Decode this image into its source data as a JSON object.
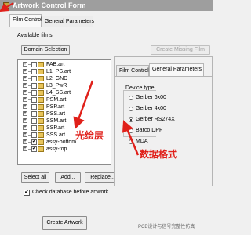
{
  "window": {
    "title": "Artwork Control Form"
  },
  "tabs": [
    {
      "label": "Film Control",
      "active": true
    },
    {
      "label": "General Parameters",
      "active": false
    }
  ],
  "available_films_label": "Available films",
  "buttons": {
    "domain_selection": "Domain Selection",
    "create_missing_film": "Create Missing Film",
    "select_all": "Select all",
    "add": "Add...",
    "replace": "Replace...",
    "create_artwork": "Create Artwork"
  },
  "films": [
    {
      "name": "FAB.art",
      "checked": false
    },
    {
      "name": "L1_PS.art",
      "checked": false
    },
    {
      "name": "L2_GND",
      "checked": false
    },
    {
      "name": "L3_PwR",
      "checked": false
    },
    {
      "name": "L4_SS.art",
      "checked": false
    },
    {
      "name": "PSM.art",
      "checked": false
    },
    {
      "name": "PSP.art",
      "checked": false
    },
    {
      "name": "PSS.art",
      "checked": false
    },
    {
      "name": "SSM.art",
      "checked": false
    },
    {
      "name": "SSP.art",
      "checked": false
    },
    {
      "name": "SSS.art",
      "checked": false
    },
    {
      "name": "assy-bottom",
      "checked": true
    },
    {
      "name": "assy-top",
      "checked": true
    }
  ],
  "check_db": {
    "label": "Check database before artwork",
    "checked": true
  },
  "overlay": {
    "tabs": [
      {
        "label": "Film Control",
        "active": false
      },
      {
        "label": "General Parameters",
        "active": true
      }
    ],
    "device_type_label": "Device type",
    "device_types": [
      {
        "label": "Gerber 6x00",
        "selected": false
      },
      {
        "label": "Gerber 4x00",
        "selected": false
      },
      {
        "label": "Gerber RS274X",
        "selected": true
      },
      {
        "label": "Barco DPF",
        "selected": false
      },
      {
        "label": "MDA",
        "selected": false
      }
    ]
  },
  "annotations": {
    "layer_label": "光绘层",
    "format_label": "数据格式"
  },
  "watermark": "PCB设计与信号完整性仿真",
  "colors": {
    "annotation_red": "#e0201a",
    "folder_yellow": "#e8c45a"
  }
}
